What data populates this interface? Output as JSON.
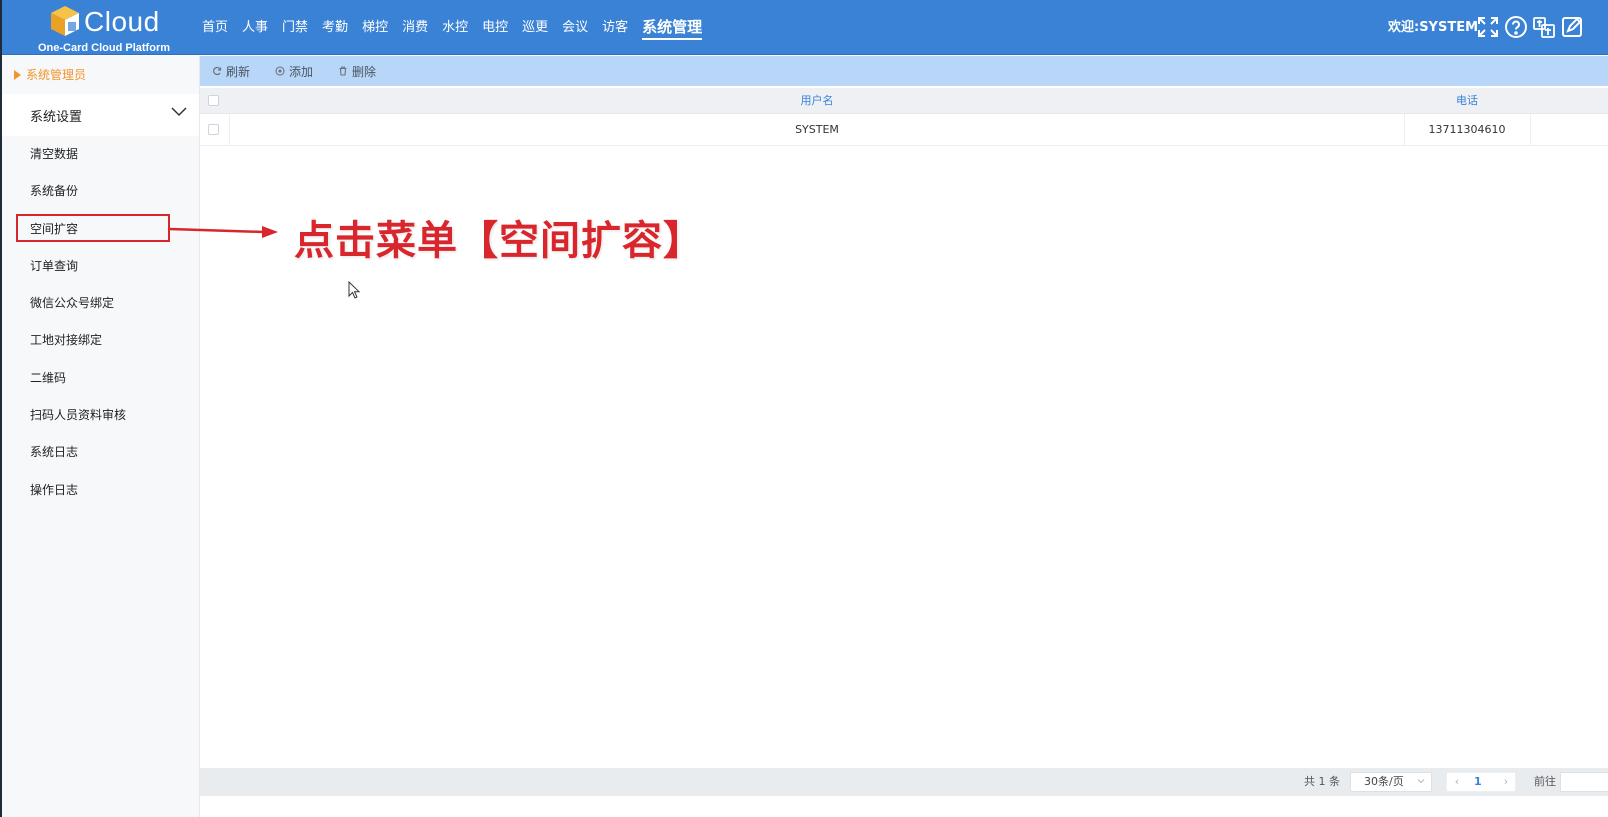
{
  "header": {
    "logo_text": "Cloud",
    "logo_subtitle": "One-Card Cloud Platform",
    "nav": [
      {
        "label": "首页"
      },
      {
        "label": "人事"
      },
      {
        "label": "门禁"
      },
      {
        "label": "考勤"
      },
      {
        "label": "梯控"
      },
      {
        "label": "消费"
      },
      {
        "label": "水控"
      },
      {
        "label": "电控"
      },
      {
        "label": "巡更"
      },
      {
        "label": "会议"
      },
      {
        "label": "访客"
      },
      {
        "label": "系统管理",
        "active": true
      }
    ],
    "welcome": "欢迎:SYSTEM",
    "icons": [
      "fullscreen-icon",
      "help-icon",
      "language-icon",
      "edit-icon"
    ]
  },
  "sidebar": {
    "role": "系统管理员",
    "group_label": "系统设置",
    "items": [
      {
        "label": "清空数据"
      },
      {
        "label": "系统备份"
      },
      {
        "label": "空间扩容",
        "highlighted": true
      },
      {
        "label": "订单查询"
      },
      {
        "label": "微信公众号绑定"
      },
      {
        "label": "工地对接绑定"
      },
      {
        "label": "二维码"
      },
      {
        "label": "扫码人员资料审核"
      },
      {
        "label": "系统日志"
      },
      {
        "label": "操作日志"
      }
    ]
  },
  "toolbar": {
    "refresh_label": "刷新",
    "add_label": "添加",
    "delete_label": "删除"
  },
  "table": {
    "columns": [
      "用户名",
      "电话"
    ],
    "rows": [
      {
        "username": "SYSTEM",
        "phone": "13711304610"
      }
    ]
  },
  "annotation": {
    "text": "点击菜单【空间扩容】",
    "color": "#d9262c"
  },
  "pagination": {
    "total": "共 1 条",
    "page_size": "30条/页",
    "current_page": "1",
    "goto_label": "前往"
  },
  "colors": {
    "header_bg": "#3a82d6",
    "toolbar_bg": "#b8d6f7",
    "role_color": "#f0962e",
    "highlight": "#d9262c"
  }
}
